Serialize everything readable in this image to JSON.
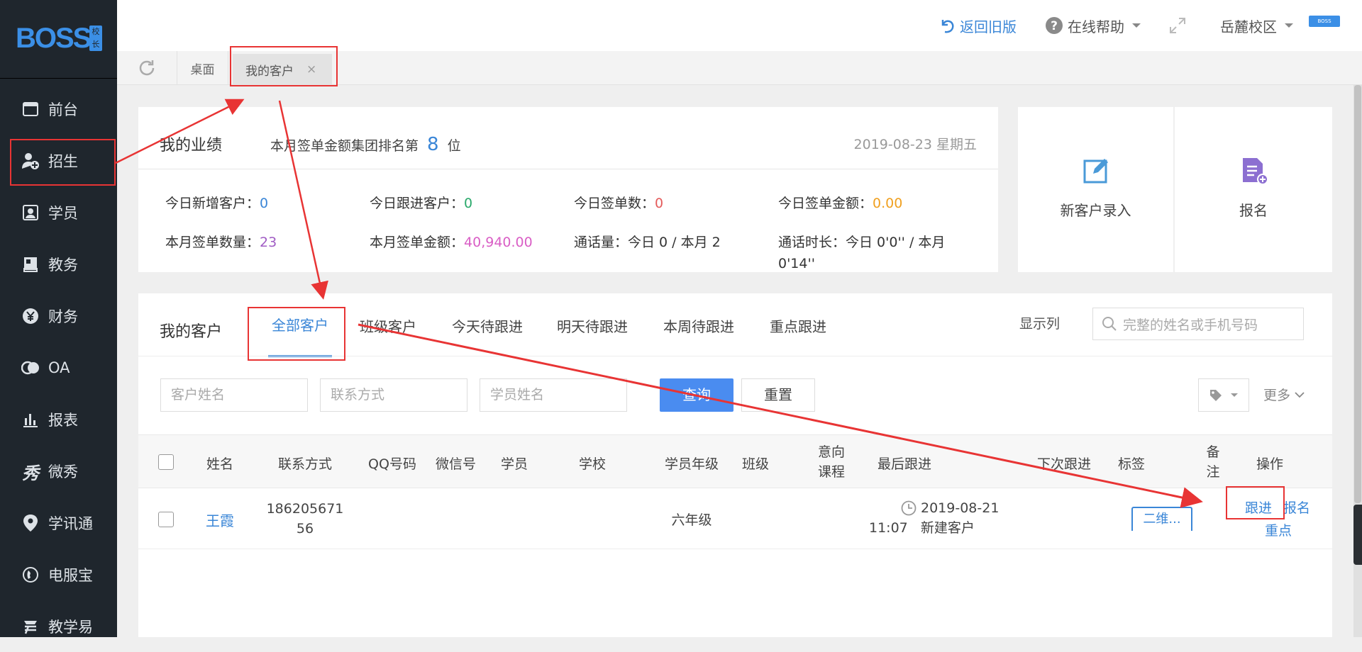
{
  "sidebar": {
    "logo": "BOSS",
    "logo_seal": "校长",
    "items": [
      {
        "label": "前台",
        "icon": "calendar-icon"
      },
      {
        "label": "招生",
        "icon": "add-user-icon"
      },
      {
        "label": "学员",
        "icon": "student-card-icon"
      },
      {
        "label": "教务",
        "icon": "book-icon"
      },
      {
        "label": "财务",
        "icon": "yen-icon"
      },
      {
        "label": "OA",
        "icon": "oa-icon"
      },
      {
        "label": "报表",
        "icon": "bar-chart-icon"
      },
      {
        "label": "微秀",
        "icon": "xiu-icon"
      },
      {
        "label": "学讯通",
        "icon": "location-pin-icon"
      },
      {
        "label": "电服宝",
        "icon": "phone-icon"
      },
      {
        "label": "教学易",
        "icon": "teach-icon"
      }
    ]
  },
  "topbar": {
    "back_old": "返回旧版",
    "help": "在线帮助",
    "campus": "岳麓校区",
    "badge": "BOSS"
  },
  "tabs": [
    {
      "label": "桌面"
    },
    {
      "label": "我的客户",
      "close": "×"
    }
  ],
  "performance": {
    "title": "我的业绩",
    "rank_prefix": "本月签单金额集团排名第",
    "rank_value": "8",
    "rank_suffix": "位",
    "date": "2019-08-23 星期五",
    "stats": [
      {
        "label": "今日新增客户：",
        "value": "0",
        "color": "#3a86d7"
      },
      {
        "label": "今日跟进客户：",
        "value": "0",
        "color": "#2aa96b"
      },
      {
        "label": "今日签单数：",
        "value": "0",
        "color": "#e45b5b"
      },
      {
        "label": "今日签单金额：",
        "value": "0.00",
        "color": "#f0a020"
      },
      {
        "label": "本月签单数量：",
        "value": "23",
        "color": "#a05cc4"
      },
      {
        "label": "本月签单金额：",
        "value": "40,940.00",
        "color": "#d95ec5"
      },
      {
        "label": "通话量：",
        "value": "今日 0 / 本月 2",
        "color": "#333333"
      },
      {
        "label": "通话时长：",
        "value": "今日 0'0'' / 本月 0'14''",
        "color": "#333333"
      }
    ]
  },
  "quick_actions": [
    {
      "label": "新客户录入",
      "icon": "edit-icon"
    },
    {
      "label": "报名",
      "icon": "enroll-doc-icon"
    }
  ],
  "customers": {
    "title": "我的客户",
    "tabs": [
      "全部客户",
      "班级客户",
      "今天待跟进",
      "明天待跟进",
      "本周待跟进",
      "重点跟进"
    ],
    "show_columns": "显示列",
    "search_placeholder": "完整的姓名或手机号码",
    "filters": {
      "customer_name": "客户姓名",
      "contact": "联系方式",
      "student_name": "学员姓名",
      "query": "查询",
      "reset": "重置",
      "more": "更多"
    },
    "columns": [
      "姓名",
      "联系方式",
      "QQ号码",
      "微信号",
      "学员",
      "学校",
      "学员年级",
      "班级",
      "意向\n课程",
      "最后跟进",
      "下次跟进",
      "标签",
      "备\n注",
      "操作"
    ],
    "rows": [
      {
        "name": "王霞",
        "contact": "18620567156",
        "grade": "六年级",
        "last_date": "2019-08-21",
        "last_time": "11:07",
        "last_note": "新建客户",
        "tag": "二维...",
        "actions": [
          "跟进",
          "报名",
          "重点"
        ]
      }
    ]
  },
  "colors": {
    "sidebar_bg": "#1f262d",
    "accent": "#3a86d7",
    "query_button": "#4a8cf0",
    "annotation": "#e83434"
  }
}
